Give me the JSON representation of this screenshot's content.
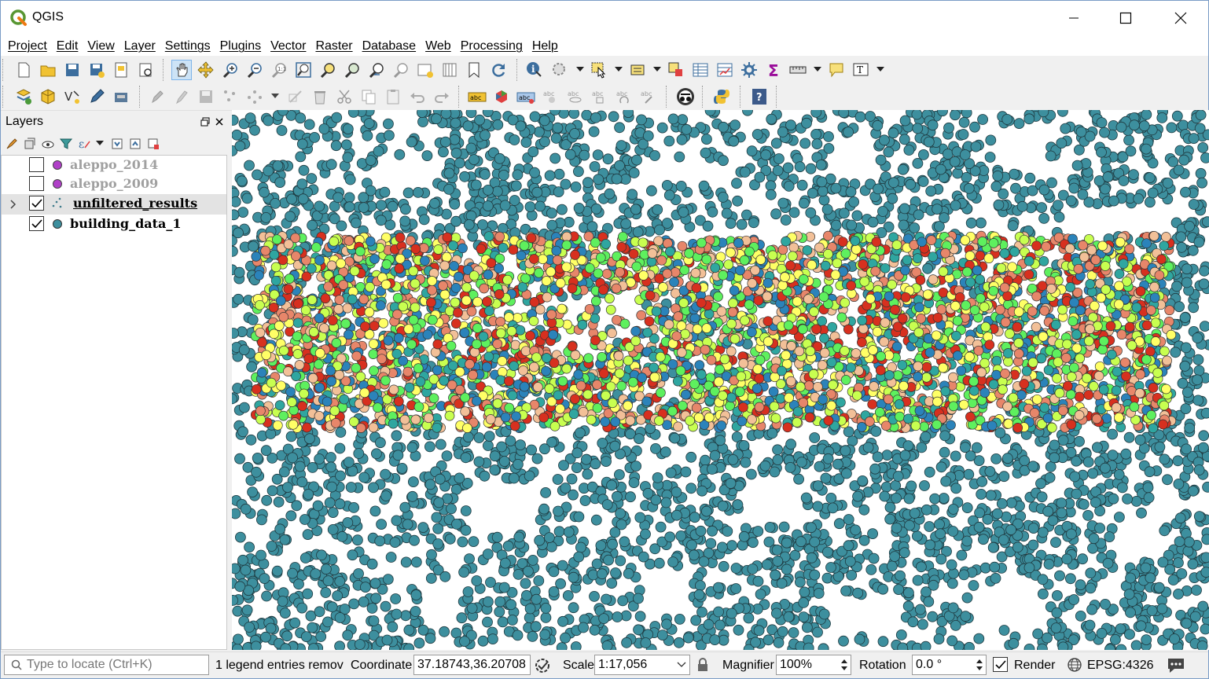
{
  "window": {
    "title": "QGIS",
    "controls": [
      "minimize-icon",
      "maximize-icon",
      "close-icon"
    ]
  },
  "menubar": {
    "items": [
      "Project",
      "Edit",
      "View",
      "Layer",
      "Settings",
      "Plugins",
      "Vector",
      "Raster",
      "Database",
      "Web",
      "Processing",
      "Help"
    ]
  },
  "toolbar_row1": {
    "icons": [
      "new-project-icon",
      "open-project-icon",
      "save-project-icon",
      "save-as-icon",
      "new-print-layout-icon",
      "layout-manager-icon",
      "pan-icon",
      "pan-to-selection-icon",
      "zoom-in-icon",
      "zoom-out-icon",
      "zoom-native-icon",
      "zoom-full-icon",
      "zoom-to-selection-icon",
      "zoom-to-layer-icon",
      "zoom-last-icon",
      "zoom-next-icon",
      "new-map-view-icon",
      "temporal-icon",
      "bookmark-new-icon",
      "show-bookmarks-icon",
      "refresh-icon",
      "identify-icon",
      "action-icon",
      "select-icon",
      "select-by-value-icon",
      "deselect-icon",
      "attribute-table-icon",
      "field-calculator-icon",
      "processing-toolbox-icon",
      "statistics-sum-icon",
      "measure-icon",
      "map-tips-icon",
      "text-annotation-icon"
    ]
  },
  "toolbar_row2": {
    "icons": [
      "data-source-manager-icon",
      "new-geopackage-icon",
      "digitize-icon",
      "toggle-editing-icon",
      "save-edits-icon",
      "add-feature-icon",
      "vertex-tool-icon",
      "delete-selected-icon",
      "cut-features-icon",
      "copy-features-icon",
      "paste-features-icon",
      "undo-icon",
      "redo-icon",
      "label-tool-icon",
      "diagram-icon",
      "pin-labels-icon",
      "show-hide-labels-icon",
      "move-label-icon",
      "rotate-label-icon",
      "change-label-icon",
      "plugin-icon",
      "python-console-icon",
      "help-icon"
    ]
  },
  "layers_panel": {
    "title": "Layers",
    "tool_icons": [
      "open-layer-styling-icon",
      "add-group-icon",
      "manage-visibility-icon",
      "filter-legend-icon",
      "filter-expression-icon",
      "expand-all-icon",
      "collapse-all-icon",
      "remove-layer-icon"
    ],
    "layers": [
      {
        "name": "aleppo_2014",
        "checked": false,
        "symbol_color": "#b040c8",
        "active": false,
        "expandable": false,
        "underlined": false
      },
      {
        "name": "aleppo_2009",
        "checked": false,
        "symbol_color": "#b040c8",
        "active": false,
        "expandable": false,
        "underlined": false
      },
      {
        "name": "unfiltered_results",
        "checked": true,
        "symbol_color": "multi",
        "active": true,
        "expandable": true,
        "underlined": true
      },
      {
        "name": "building_data_1",
        "checked": true,
        "symbol_color": "#3d8f9e",
        "active": false,
        "expandable": false,
        "underlined": false
      }
    ]
  },
  "map_canvas": {
    "building_color": "#3d8f9e",
    "result_colors": [
      "#d7301f",
      "#e7866a",
      "#f2c098",
      "#ffff66",
      "#c8ff50",
      "#5ef05e",
      "#2fa6a0",
      "#2b83ba"
    ]
  },
  "statusbar": {
    "locator_placeholder": "Type to locate (Ctrl+K)",
    "message": "1 legend entries remov",
    "coordinate_label": "Coordinate",
    "coordinate_value": "37.18743,36.20708",
    "scale_label": "Scale",
    "scale_value": "1:17,056",
    "magnifier_label": "Magnifier",
    "magnifier_value": "100%",
    "rotation_label": "Rotation",
    "rotation_value": "0.0 °",
    "render_label": "Render",
    "render_checked": true,
    "crs": "EPSG:4326"
  }
}
